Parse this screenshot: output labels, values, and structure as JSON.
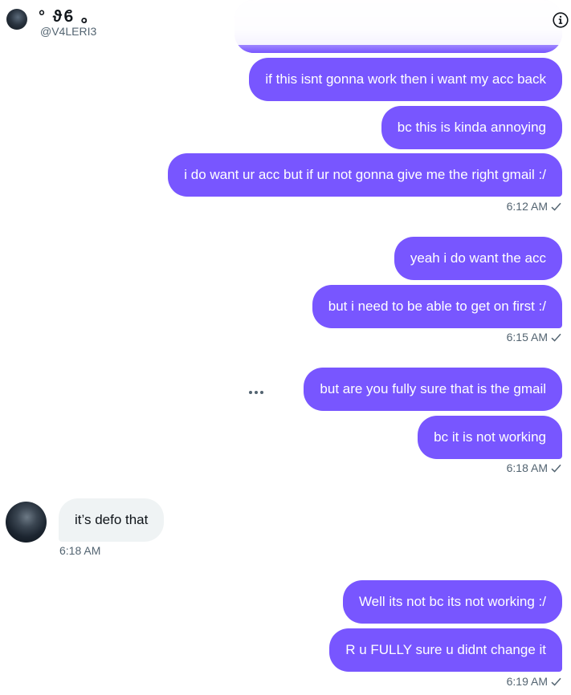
{
  "header": {
    "name": "° ϑϐ ｡",
    "handle": "@V4LERI3"
  },
  "messages": [
    {
      "text": "if this isnt gonna work then i want my acc back"
    },
    {
      "text": "bc this is kinda annoying"
    },
    {
      "text": "i do want ur acc but if ur not gonna give me the right gmail :/"
    },
    {
      "text": "yeah i do want the acc"
    },
    {
      "text": "but i need to be able to get on first :/"
    },
    {
      "text": "but are you fully sure that is the gmail"
    },
    {
      "text": "bc it is not working"
    },
    {
      "text": "it’s defo that"
    },
    {
      "text": "Well its not bc its not working :/"
    },
    {
      "text": "R u FULLY sure u didnt change it"
    }
  ],
  "timestamps": [
    "6:12 AM",
    "6:15 AM",
    "6:18 AM",
    "6:18 AM",
    "6:19 AM"
  ],
  "colors": {
    "outgoing_bubble": "#7856ff",
    "incoming_bubble": "#eff3f4",
    "timestamp": "#536471"
  },
  "icons": {
    "info": "info-icon",
    "more": "more-options-icon",
    "sent": "checkmark-icon"
  }
}
